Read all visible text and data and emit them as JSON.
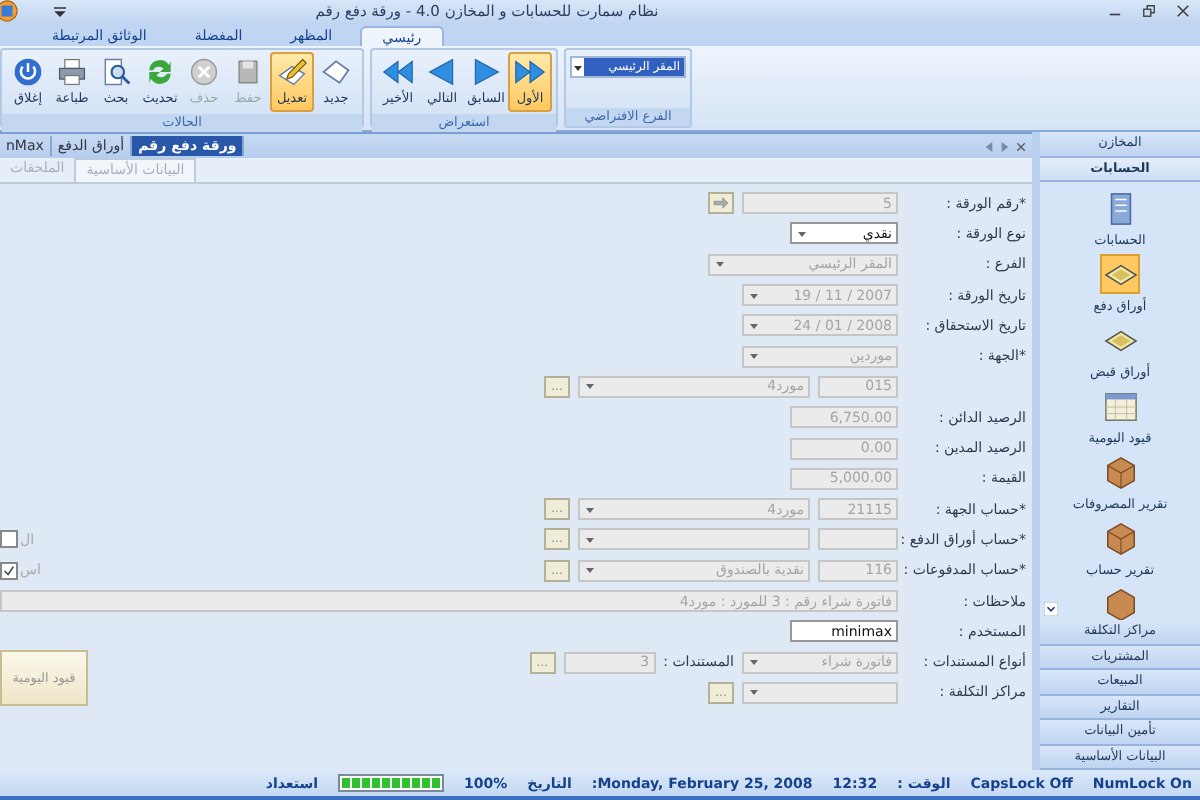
{
  "window": {
    "title": "نظام سمارت للحسابات و المخازن 4.0 - ورقة دفع رقم"
  },
  "ribbon": {
    "tabs": [
      {
        "label": "رئيسي",
        "selected": true
      },
      {
        "label": "المظهر",
        "selected": false
      },
      {
        "label": "المفضلة",
        "selected": false
      },
      {
        "label": "الوثائق المرتبطة",
        "selected": false
      }
    ],
    "groups": [
      {
        "title": "الفرع الافتراضي",
        "kind": "dropdown",
        "value": "المقر الرئيسي"
      },
      {
        "title": "استعراض",
        "kind": "buttons",
        "buttons": [
          {
            "label": "الأول",
            "selected": true,
            "disabled": false
          },
          {
            "label": "السابق",
            "selected": false,
            "disabled": false
          },
          {
            "label": "التالي",
            "selected": false,
            "disabled": false
          },
          {
            "label": "الأخير",
            "selected": false,
            "disabled": false
          }
        ]
      },
      {
        "title": "الحالات",
        "kind": "buttons",
        "buttons": [
          {
            "label": "جديد",
            "selected": false,
            "disabled": false
          },
          {
            "label": "تعديل",
            "selected": true,
            "disabled": false
          },
          {
            "label": "حفظ",
            "selected": false,
            "disabled": true
          },
          {
            "label": "حذف",
            "selected": false,
            "disabled": true
          },
          {
            "label": "تحديث",
            "selected": false,
            "disabled": false
          },
          {
            "label": "بحث",
            "selected": false,
            "disabled": false
          },
          {
            "label": "طباعة",
            "selected": false,
            "disabled": false
          },
          {
            "label": "إغلاق",
            "selected": false,
            "disabled": false
          }
        ]
      }
    ]
  },
  "document_tabs": [
    {
      "label": "ورقة دفع رقم",
      "selected": true
    },
    {
      "label": "أوراق الدفع",
      "selected": false
    },
    {
      "label": "nMax",
      "selected": false
    }
  ],
  "form_tabs": [
    {
      "label": "البيانات الأساسية",
      "selected": true
    },
    {
      "label": "الملحقات",
      "selected": false
    }
  ],
  "form": {
    "rows": [
      {
        "label": "*رقم الورقة :",
        "fields": [
          {
            "kind": "text",
            "value": "5",
            "disabled": true
          },
          {
            "kind": "pick"
          }
        ]
      },
      {
        "label": "نوع الورقة :",
        "fields": [
          {
            "kind": "small_combo",
            "value": "نقدي",
            "disabled": false
          }
        ]
      },
      {
        "label": "الفرع :",
        "fields": [
          {
            "kind": "wide_combo",
            "value": "المقر الرئيسي",
            "disabled": true
          }
        ]
      },
      {
        "label": "تاريخ الورقة :",
        "fields": [
          {
            "kind": "combo",
            "value": "2007 / 11 / 19",
            "disabled": true
          }
        ]
      },
      {
        "label": "تاريخ الاستحقاق :",
        "fields": [
          {
            "kind": "combo",
            "value": "2008 / 01 / 24",
            "disabled": true
          }
        ]
      },
      {
        "label": "*الجهة :",
        "fields": [
          {
            "kind": "combo",
            "value": "موردين",
            "disabled": true
          }
        ]
      },
      {
        "fields": [
          {
            "kind": "code",
            "value": "015",
            "disabled": true
          },
          {
            "kind": "long_combo",
            "value": "مورد4",
            "disabled": true
          },
          {
            "kind": "more",
            "text": "..."
          }
        ]
      },
      {
        "label": "الرصيد الدائن :",
        "fields": [
          {
            "kind": "short",
            "value": "6,750.00",
            "disabled": true
          }
        ]
      },
      {
        "label": "الرصيد المدين :",
        "fields": [
          {
            "kind": "short",
            "value": "0.00",
            "disabled": true
          }
        ]
      },
      {
        "label": "القيمة :",
        "fields": [
          {
            "kind": "short",
            "value": "5,000.00",
            "disabled": true
          }
        ]
      },
      {
        "label": "*حساب الجهة :",
        "fields": [
          {
            "kind": "code",
            "value": "21115",
            "disabled": true
          },
          {
            "kind": "long_combo",
            "value": "مورد4",
            "disabled": true
          },
          {
            "kind": "more",
            "text": "..."
          }
        ]
      },
      {
        "label": "*حساب أوراق الدفع :",
        "fields": [
          {
            "kind": "code",
            "disabled": true
          },
          {
            "kind": "long_combo",
            "disabled": true
          },
          {
            "kind": "more",
            "text": "..."
          }
        ],
        "option": {
          "label": "ال",
          "checked": false
        }
      },
      {
        "label": "*حساب المدفوعات :",
        "fields": [
          {
            "kind": "code",
            "value": "116",
            "disabled": true
          },
          {
            "kind": "long_combo",
            "value": "نقدية بالصندوق",
            "disabled": true
          },
          {
            "kind": "more",
            "text": "..."
          }
        ],
        "option": {
          "label": "اس",
          "checked": true
        }
      },
      {
        "label": "ملاحظات :",
        "fields": [
          {
            "kind": "notes",
            "value": "فاتورة شراء رقم : 3 للمورد : مورد4",
            "disabled": true
          }
        ]
      },
      {
        "label": "المستخدم :",
        "fields": [
          {
            "kind": "short",
            "value": "minimax",
            "disabled": false
          }
        ]
      },
      {
        "label": "أنواع المستندات :",
        "fields": [
          {
            "kind": "combo",
            "value": "فاتورة شراء",
            "disabled": true
          },
          {
            "kind": "label",
            "text": "المستندات :"
          },
          {
            "kind": "count",
            "value": "3",
            "disabled": true
          },
          {
            "kind": "more",
            "text": "..."
          }
        ],
        "side_button": "قيود اليومية"
      },
      {
        "label": "مراكز التكلفة :",
        "fields": [
          {
            "kind": "combo",
            "disabled": true
          },
          {
            "kind": "more",
            "text": "..."
          }
        ]
      }
    ]
  },
  "sidebar": {
    "sections": [
      {
        "label": "المخازن",
        "expanded": false
      },
      {
        "label": "الحسابات",
        "expanded": true,
        "items": [
          {
            "label": "الحسابات",
            "selected": false
          },
          {
            "label": "أوراق دفع",
            "selected": true
          },
          {
            "label": "أوراق قبض",
            "selected": false
          },
          {
            "label": "قيود اليومية",
            "selected": false
          },
          {
            "label": "تقرير المصروفات",
            "selected": false
          },
          {
            "label": "تقرير حساب",
            "selected": false
          }
        ]
      },
      {
        "label": "مراكز التكلفة",
        "expanded": false
      },
      {
        "label": "المشتريات",
        "expanded": false
      },
      {
        "label": "المبيعات",
        "expanded": false
      },
      {
        "label": "التقارير",
        "expanded": false
      },
      {
        "label": "تأمين البيانات",
        "expanded": false
      },
      {
        "label": "البيانات الأساسية",
        "expanded": false
      }
    ]
  },
  "status_bar": {
    "num_lock": "NumLock On",
    "caps_lock": "CapsLock Off",
    "time_label": "الوقت :",
    "time": "12:32",
    "date": ":Monday, February 25, 2008",
    "date_label": "التاريخ",
    "zoom": "100%",
    "progress": {
      "level": 1
    },
    "status": "استعداد"
  }
}
